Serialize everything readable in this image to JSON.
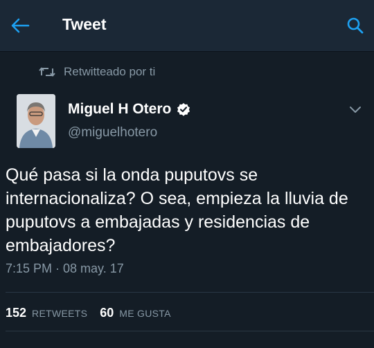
{
  "header": {
    "title": "Tweet",
    "back_icon": "arrow-left-icon",
    "search_icon": "search-icon",
    "accent_color": "#1da1f2"
  },
  "retweet_context": {
    "icon": "retweet-icon",
    "text": "Retwitteado por ti"
  },
  "author": {
    "name": "Miguel H Otero",
    "handle": "@miguelhotero",
    "verified": true
  },
  "tweet": {
    "text": "Qué pasa si la onda puputovs se internacionaliza? O sea, empieza la lluvia de puputovs a embajadas y residencias de embajadores?",
    "timestamp": "7:15 PM · 08 may. 17"
  },
  "stats": {
    "retweets_count": "152",
    "retweets_label": "RETWEETS",
    "likes_count": "60",
    "likes_label": "ME GUSTA"
  }
}
